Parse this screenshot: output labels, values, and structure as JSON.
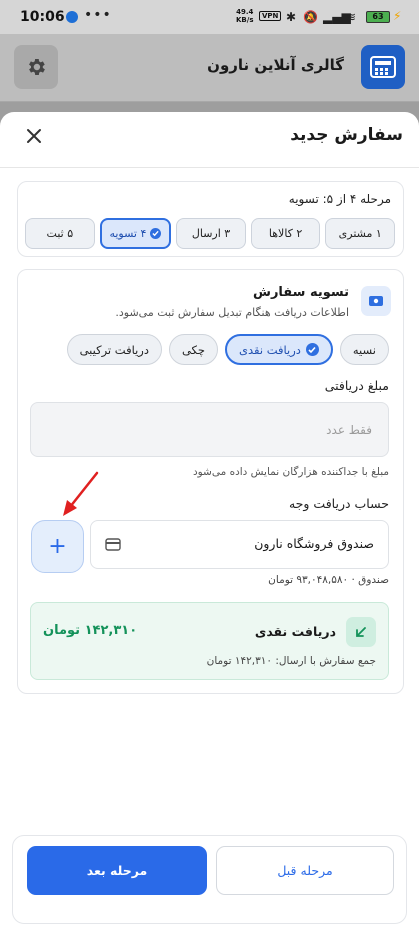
{
  "status_bar": {
    "time": "10:06",
    "dots": "•••",
    "net_speed": "49.4",
    "net_unit": "KB/s",
    "vpn": "VPN",
    "battery": "63"
  },
  "app_bar": {
    "title": "گالری آنلاین نارون"
  },
  "sheet": {
    "title": "سفارش جدید"
  },
  "steps": {
    "caption": "مرحله ۴ از ۵: تسویه",
    "items": [
      {
        "label": "۱ مشتری"
      },
      {
        "label": "۲ کالاها"
      },
      {
        "label": "۳ ارسال"
      },
      {
        "label": "۴ تسویه"
      },
      {
        "label": "۵ ثبت"
      }
    ],
    "active_index": 3
  },
  "settlement": {
    "title": "تسویه سفارش",
    "subtitle": "اطلاعات دریافت هنگام تبدیل سفارش ثبت می‌شود.",
    "methods": [
      {
        "label": "نسیه"
      },
      {
        "label": "دریافت نقدی"
      },
      {
        "label": "چکی"
      },
      {
        "label": "دریافت ترکیبی"
      }
    ],
    "selected_method": "دریافت نقدی"
  },
  "amount": {
    "label": "مبلغ دریافتی",
    "placeholder": "فقط عدد",
    "value": "",
    "hint": "مبلغ با جداکننده هزارگان نمایش داده می‌شود"
  },
  "account": {
    "label": "حساب دریافت وجه",
    "selected": "صندوق فروشگاه نارون",
    "balance": "صندوق · ۹۳,۰۴۸,۵۸۰ تومان",
    "add_label": "+"
  },
  "summary": {
    "title": "دریافت نقدی",
    "amount": "۱۴۲,۳۱۰ تومان",
    "subtitle": "جمع سفارش با ارسال: ۱۴۲,۳۱۰ تومان"
  },
  "footer": {
    "prev_label": "مرحله قبل",
    "next_label": "مرحله بعد"
  },
  "colors": {
    "primary": "#2a6ae8",
    "success": "#14925a",
    "annotation_arrow": "#e02020"
  }
}
